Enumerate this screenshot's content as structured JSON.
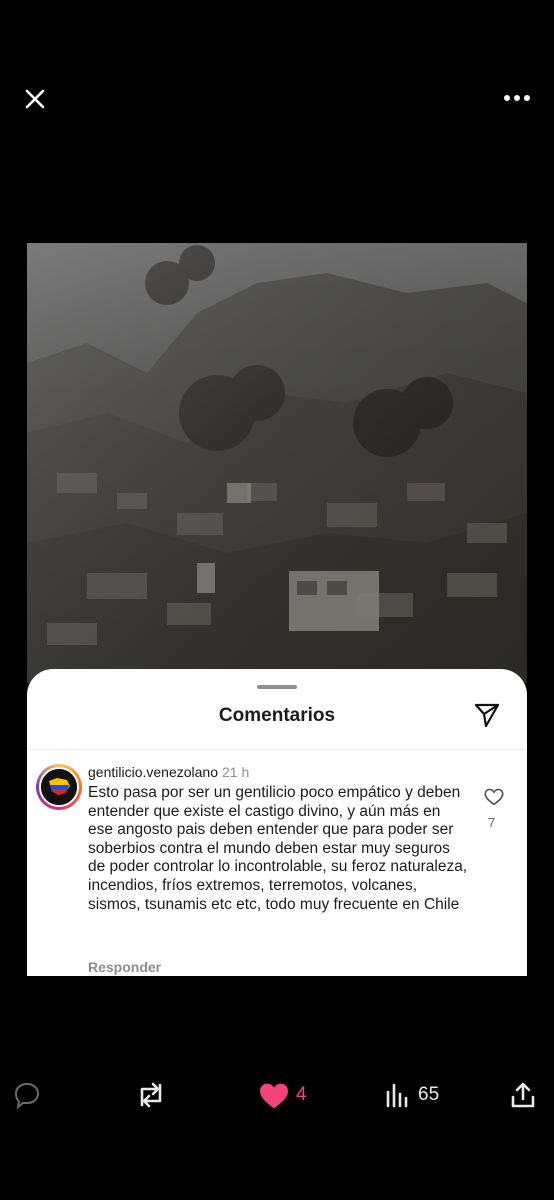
{
  "sheet": {
    "title": "Comentarios"
  },
  "comment": {
    "username": "gentilicio.venezolano",
    "time": "21 h",
    "text": "Esto pasa por ser un gentilicio poco empático y deben entender que existe el castigo divino, y aún más en ese angosto pais deben entender que para poder ser soberbios contra el mundo deben estar muy seguros de poder controlar lo incontrolable, su feroz naturaleza, incendios, fríos extremos, terremotos, volcanes, sismos, tsunamis etc etc, todo muy frecuente en Chile",
    "reply_label": "Responder",
    "like_count": "7"
  },
  "actions": {
    "like_count": "4",
    "views_count": "65"
  },
  "colors": {
    "background": "#000000",
    "like_pink": "#f2437d",
    "sheet_bg": "#ffffff"
  },
  "icons": [
    "close-icon",
    "more-icon",
    "send-icon",
    "heart-outline-icon",
    "reply-bubble-icon",
    "retweet-icon",
    "heart-filled-icon",
    "views-icon",
    "share-icon"
  ]
}
